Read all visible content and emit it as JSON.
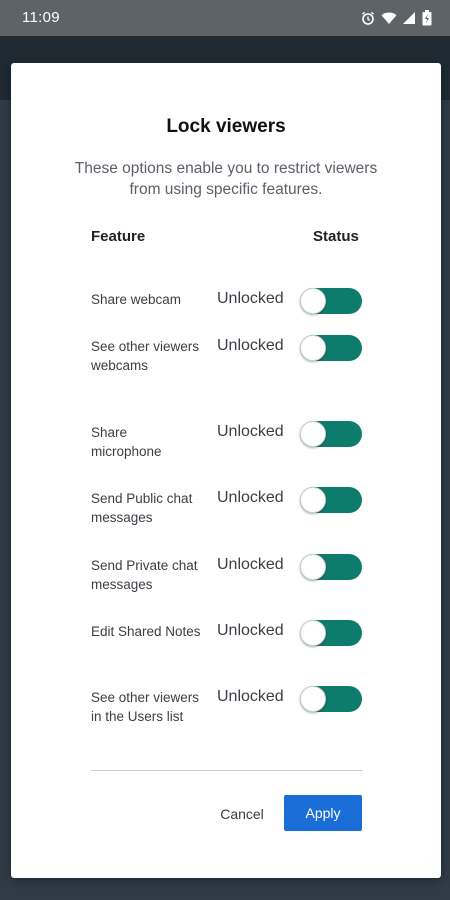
{
  "status_bar": {
    "time": "11:09",
    "icons": [
      "alarm-icon",
      "wifi-icon",
      "signal-icon",
      "battery-icon"
    ]
  },
  "dialog": {
    "title": "Lock viewers",
    "description": "These options enable you to restrict viewers from using specific features.",
    "column_feature": "Feature",
    "column_status": "Status",
    "rows": [
      {
        "label": "Share webcam",
        "state": "Unlocked"
      },
      {
        "label": "See other viewers webcams",
        "state": "Unlocked"
      },
      {
        "label": "Share microphone",
        "state": "Unlocked"
      },
      {
        "label": "Send Public chat messages",
        "state": "Unlocked"
      },
      {
        "label": "Send Private chat messages",
        "state": "Unlocked"
      },
      {
        "label": "Edit Shared Notes",
        "state": "Unlocked"
      },
      {
        "label": "See other viewers in the Users list",
        "state": "Unlocked"
      }
    ],
    "cancel_label": "Cancel",
    "apply_label": "Apply"
  },
  "colors": {
    "toggle_track": "#0e7c6d",
    "apply_button": "#1b6ed7",
    "status_bar": "#5e6368"
  }
}
